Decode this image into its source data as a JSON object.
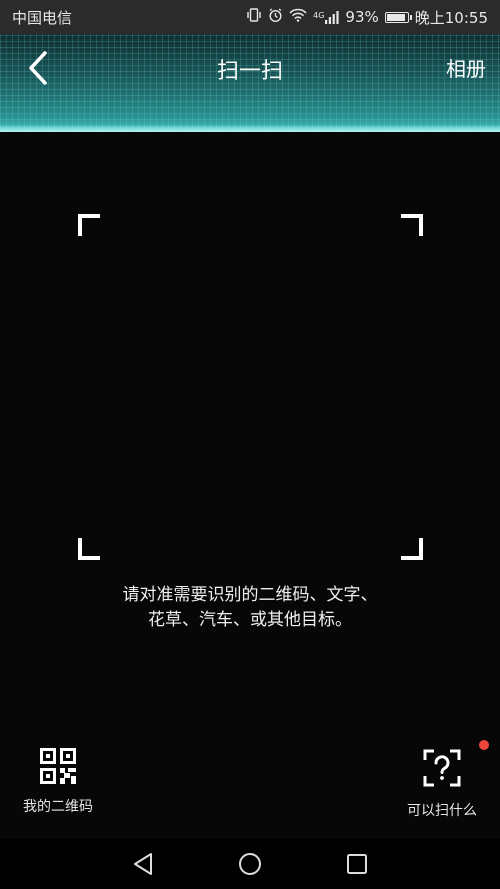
{
  "status_bar": {
    "carrier": "中国电信",
    "network": "4G",
    "battery": "93%",
    "battery_level": 0.93,
    "time": "晚上10:55"
  },
  "header": {
    "title": "扫一扫",
    "album_label": "相册",
    "back_icon": "chevron-left-icon"
  },
  "scanner": {
    "hint_line1": "请对准需要识别的二维码、文字、",
    "hint_line2": "花草、汽车、或其他目标。"
  },
  "actions": {
    "my_qr_label": "我的二维码",
    "my_qr_icon": "qr-code-icon",
    "help_label": "可以扫什么",
    "help_icon": "question-scan-icon",
    "badge_color": "#f0463c"
  },
  "nav": {
    "back_icon": "nav-back-icon",
    "home_icon": "nav-home-icon",
    "recent_icon": "nav-recent-icon"
  },
  "colors": {
    "header_accent": "#2a9090",
    "background": "#070707"
  }
}
